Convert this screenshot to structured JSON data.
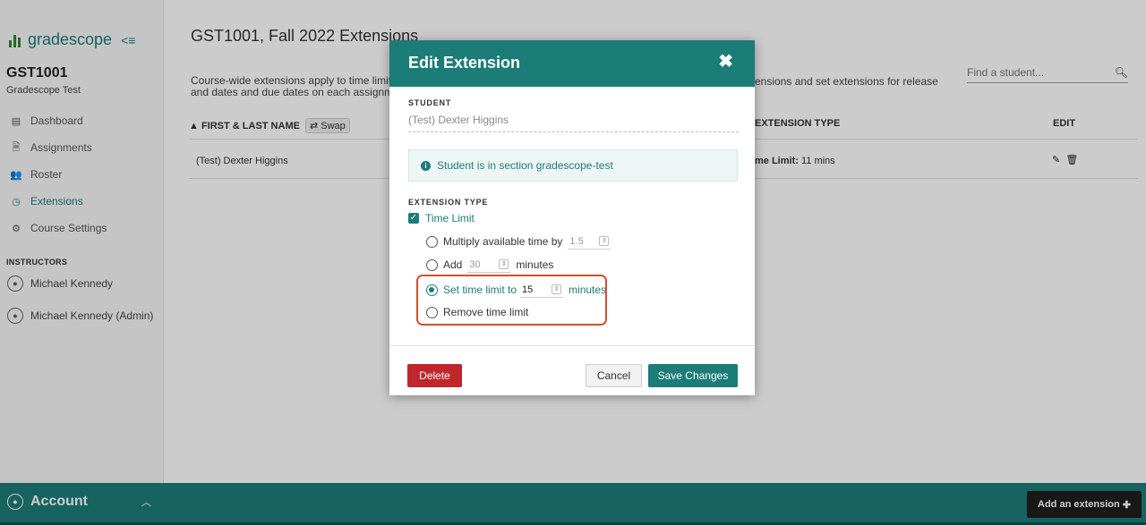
{
  "sidebar": {
    "logo_text": "gradescope",
    "collapse_glyph": "<≡",
    "course_code": "GST1001",
    "course_name": "Gradescope Test",
    "nav": [
      {
        "label": "Dashboard",
        "icon": "dashboard-icon",
        "active": false
      },
      {
        "label": "Assignments",
        "icon": "assignments-icon",
        "active": false
      },
      {
        "label": "Roster",
        "icon": "roster-icon",
        "active": false
      },
      {
        "label": "Extensions",
        "icon": "clock-icon",
        "active": true
      },
      {
        "label": "Course Settings",
        "icon": "gear-icon",
        "active": false
      }
    ],
    "instructors_title": "INSTRUCTORS",
    "instructors": [
      "Michael Kennedy",
      "Michael Kennedy (Admin)"
    ]
  },
  "main": {
    "title": "GST1001, Fall 2022 Extensions",
    "description": "Course-wide extensions apply to time limits and dates and due dates on each assignment",
    "description_right": "ensions and set extensions for release",
    "search_placeholder": "Find a student...",
    "table": {
      "headers": {
        "name": "FIRST & LAST NAME",
        "swap": "⇄ Swap",
        "extension_type": "EXTENSION TYPE",
        "edit": "EDIT"
      },
      "rows": [
        {
          "name": "(Test) Dexter Higgins",
          "ext_label": "me Limit:",
          "ext_value": " 11 mins"
        }
      ]
    }
  },
  "modal": {
    "title": "Edit Extension",
    "student_label": "STUDENT",
    "student_value": "(Test) Dexter Higgins",
    "info_text": "Student is in section gradescope-test",
    "ext_type_label": "EXTENSION TYPE",
    "time_limit_label": "Time Limit",
    "options": {
      "multiply_label": "Multiply available time by",
      "multiply_value": "1.5",
      "add_label": "Add",
      "add_value": "30",
      "add_unit": "minutes",
      "set_label": "Set time limit to",
      "set_value": "15",
      "set_unit": "minutes",
      "remove_label": "Remove time limit"
    },
    "selected_option": "set",
    "buttons": {
      "delete": "Delete",
      "cancel": "Cancel",
      "save": "Save Changes"
    }
  },
  "footer": {
    "account_label": "Account",
    "add_extension_label": "Add an extension"
  },
  "colors": {
    "brand": "#1c7c78",
    "danger": "#c0262c",
    "highlight": "#d24f2e"
  }
}
